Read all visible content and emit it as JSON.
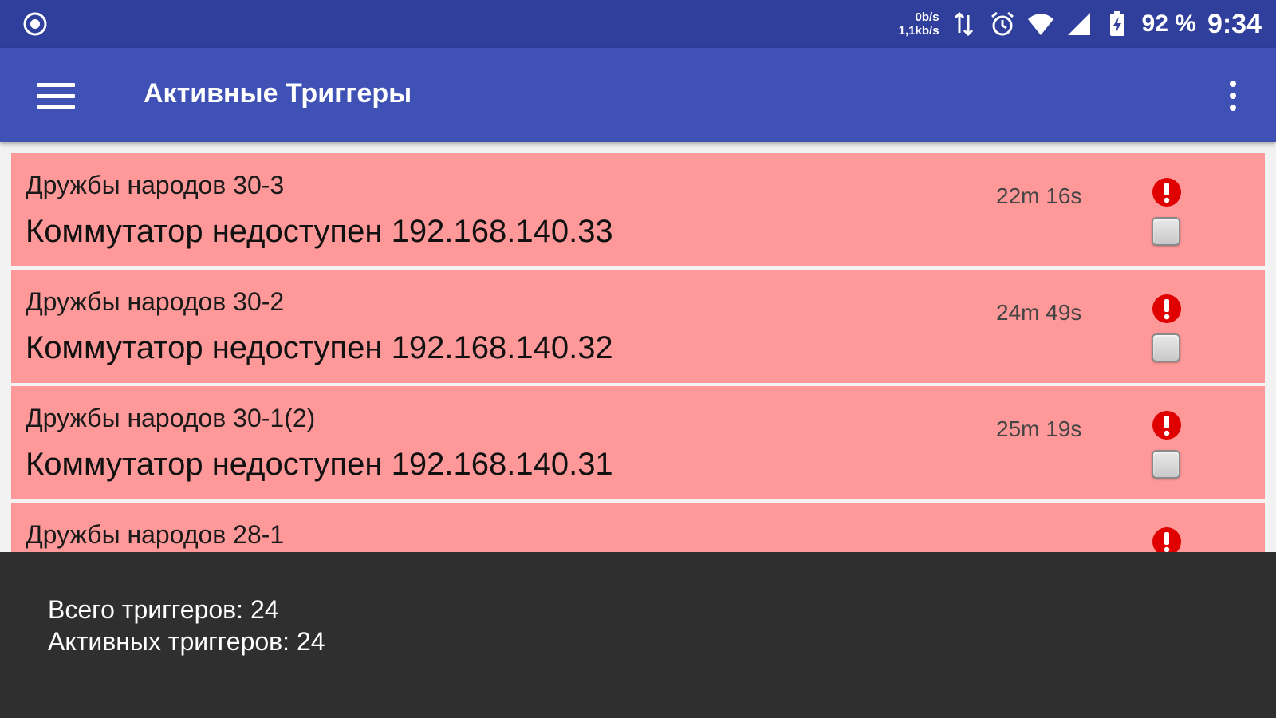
{
  "status_bar": {
    "net_down": "0b/s",
    "net_up": "1,1kb/s",
    "battery": "92 %",
    "time": "9:34",
    "icons": [
      "record-icon",
      "data-transfer-icon",
      "alarm-icon",
      "wifi-icon",
      "signal-icon",
      "battery-charging-icon"
    ]
  },
  "app_bar": {
    "title": "Активные Триггеры",
    "menu_icon": "hamburger-menu-icon",
    "overflow_icon": "more-vert-icon",
    "color": "#3f51b5"
  },
  "triggers": [
    {
      "host": "Дружбы народов 30-3",
      "description": "Коммутатор недоступен 192.168.140.33",
      "age": "22m 16s",
      "severity_icon": "exclamation-icon",
      "acknowledged": false
    },
    {
      "host": "Дружбы народов 30-2",
      "description": "Коммутатор недоступен 192.168.140.32",
      "age": "24m 49s",
      "severity_icon": "exclamation-icon",
      "acknowledged": false
    },
    {
      "host": "Дружбы народов 30-1(2)",
      "description": "Коммутатор недоступен 192.168.140.31",
      "age": "25m 19s",
      "severity_icon": "exclamation-icon",
      "acknowledged": false
    },
    {
      "host": "Дружбы народов 28-1",
      "description": "",
      "age": "",
      "severity_icon": "exclamation-icon",
      "acknowledged": false
    }
  ],
  "summary": {
    "total": "Всего триггеров: 24",
    "active": "Активных триггеров: 24"
  },
  "colors": {
    "status_bar": "#2f3f9b",
    "trigger_bg": "#ff9999",
    "alert_red": "#e00000",
    "summary_bg": "#2f2f2f"
  }
}
